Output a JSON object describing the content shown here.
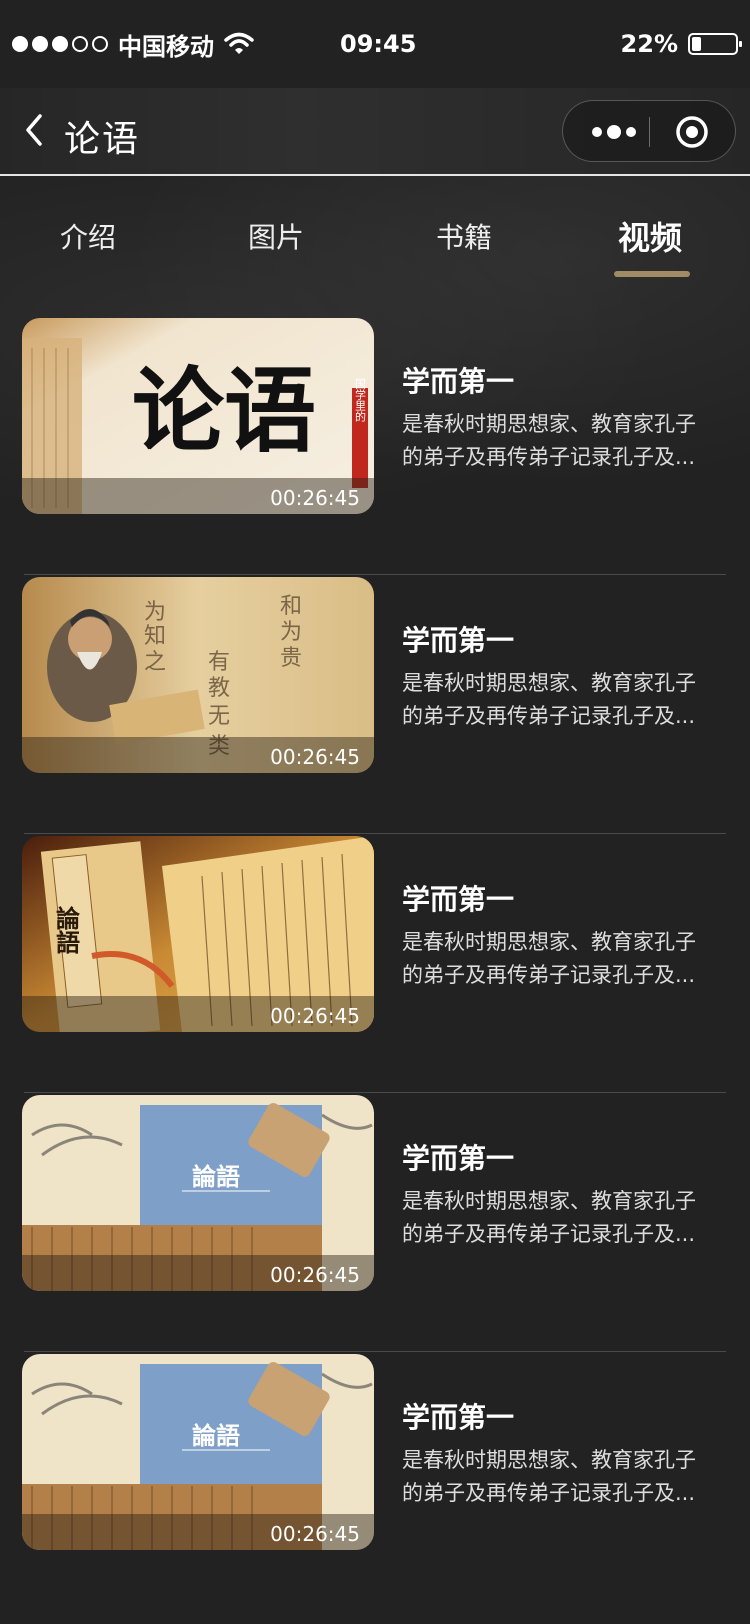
{
  "status": {
    "carrier": "中国移动",
    "time": "09:45",
    "battery": "22%",
    "battery_level": 0.22
  },
  "nav": {
    "title": "论语"
  },
  "tabs": [
    {
      "label": "介绍",
      "active": false
    },
    {
      "label": "图片",
      "active": false
    },
    {
      "label": "书籍",
      "active": false
    },
    {
      "label": "视频",
      "active": true
    }
  ],
  "videos": [
    {
      "title": "学而第一",
      "desc": "是春秋时期思想家、教育家孔子的弟子及再传弟子记录孔子及...",
      "duration": "00:26:45",
      "thumb_text": "论语",
      "thumb_tag": "国学里的"
    },
    {
      "title": "学而第一",
      "desc": "是春秋时期思想家、教育家孔子的弟子及再传弟子记录孔子及...",
      "duration": "00:26:45"
    },
    {
      "title": "学而第一",
      "desc": "是春秋时期思想家、教育家孔子的弟子及再传弟子记录孔子及...",
      "duration": "00:26:45",
      "thumb_text": "論語"
    },
    {
      "title": "学而第一",
      "desc": "是春秋时期思想家、教育家孔子的弟子及再传弟子记录孔子及...",
      "duration": "00:26:45",
      "thumb_text": "論語"
    },
    {
      "title": "学而第一",
      "desc": "是春秋时期思想家、教育家孔子的弟子及再传弟子记录孔子及...",
      "duration": "00:26:45",
      "thumb_text": "論語"
    }
  ],
  "colors": {
    "background": "#222222",
    "tab_indicator": "#a08b64",
    "separator": "#4a4a4a"
  }
}
